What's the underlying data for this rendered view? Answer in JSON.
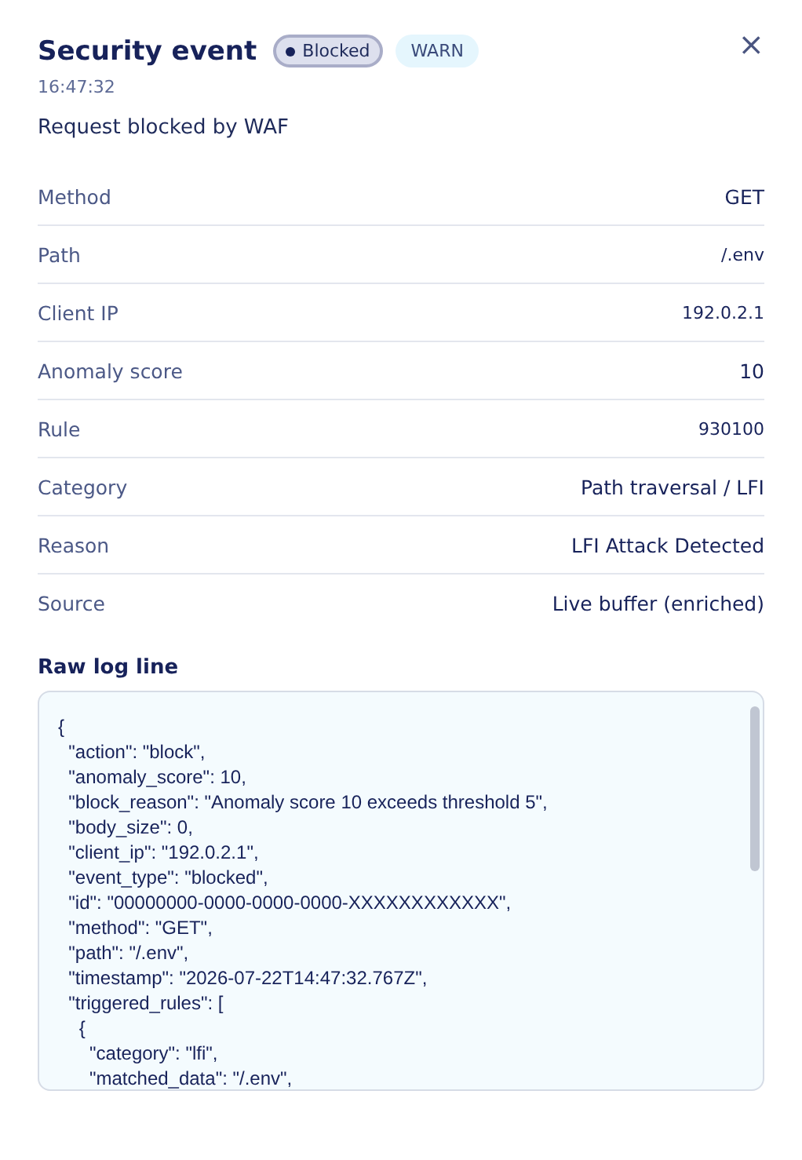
{
  "header": {
    "title": "Security event",
    "status_badge": {
      "label": "Blocked",
      "kind": "blocked"
    },
    "level_badge": {
      "label": "WARN",
      "kind": "warn"
    },
    "time": "16:47:32",
    "summary": "Request blocked by WAF",
    "close": "×"
  },
  "details": [
    {
      "label": "Method",
      "value": "GET",
      "kind": "text"
    },
    {
      "label": "Path",
      "value": "/.env",
      "kind": "mono"
    },
    {
      "label": "Client IP",
      "value": "192.0.2.1",
      "kind": "mono"
    },
    {
      "label": "Anomaly score",
      "value": "10",
      "kind": "text"
    },
    {
      "label": "Rule",
      "value": "930100",
      "kind": "mono"
    },
    {
      "label": "Category",
      "value": "Path traversal / LFI",
      "kind": "text"
    },
    {
      "label": "Reason",
      "value": "LFI Attack Detected",
      "kind": "text"
    },
    {
      "label": "Source",
      "value": "Live buffer (enriched)",
      "kind": "text"
    }
  ],
  "raw_log": {
    "heading": "Raw log line",
    "lines": [
      "{",
      "  \"action\": \"block\",",
      "  \"anomaly_score\": 10,",
      "  \"block_reason\": \"Anomaly score 10 exceeds threshold 5\",",
      "  \"body_size\": 0,",
      "  \"client_ip\": \"192.0.2.1\",",
      "  \"event_type\": \"blocked\",",
      "  \"id\": \"00000000-0000-0000-0000-XXXXXXXXXXXX\",",
      "  \"method\": \"GET\",",
      "  \"path\": \"/.env\",",
      "  \"timestamp\": \"2026-07-22T14:47:32.767Z\",",
      "  \"triggered_rules\": [",
      "    {",
      "      \"category\": \"lfi\",",
      "      \"matched_data\": \"/.env\","
    ]
  }
}
